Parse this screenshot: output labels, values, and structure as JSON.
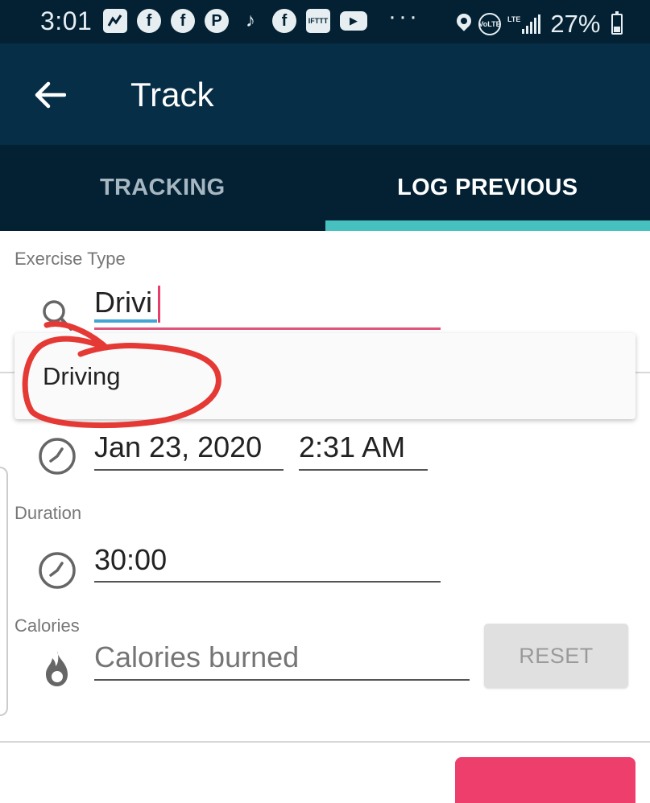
{
  "status_bar": {
    "time": "3:01",
    "app_icons": [
      "messages-icon",
      "facebook-icon",
      "facebook-icon",
      "pinterest-icon",
      "tiktok-icon",
      "facebook-icon",
      "ifttt-icon",
      "youtube-icon"
    ],
    "ifttt_label": "IFTTT",
    "more": "···",
    "volte_label": "VoLTE",
    "lte_label": "LTE",
    "battery": "27%"
  },
  "app_bar": {
    "title": "Track"
  },
  "tabs": [
    {
      "label": "TRACKING",
      "selected": false
    },
    {
      "label": "LOG PREVIOUS",
      "selected": true
    }
  ],
  "form": {
    "exercise_type_label": "Exercise Type",
    "exercise_search_value": "Drivi",
    "suggestions": [
      "Driving"
    ],
    "start_date": "Jan 23, 2020",
    "start_time": "2:31 AM",
    "duration_label": "Duration",
    "duration_value": "30:00",
    "calories_label": "Calories",
    "calories_placeholder": "Calories burned",
    "reset_label": "RESET"
  },
  "colors": {
    "status_bar_bg": "#032133",
    "app_bar_bg": "#062e47",
    "tab_indicator": "#47c1bf",
    "focus_underline": "#e0547a",
    "save_button": "#ee3e6c",
    "annotation": "#e53935"
  }
}
